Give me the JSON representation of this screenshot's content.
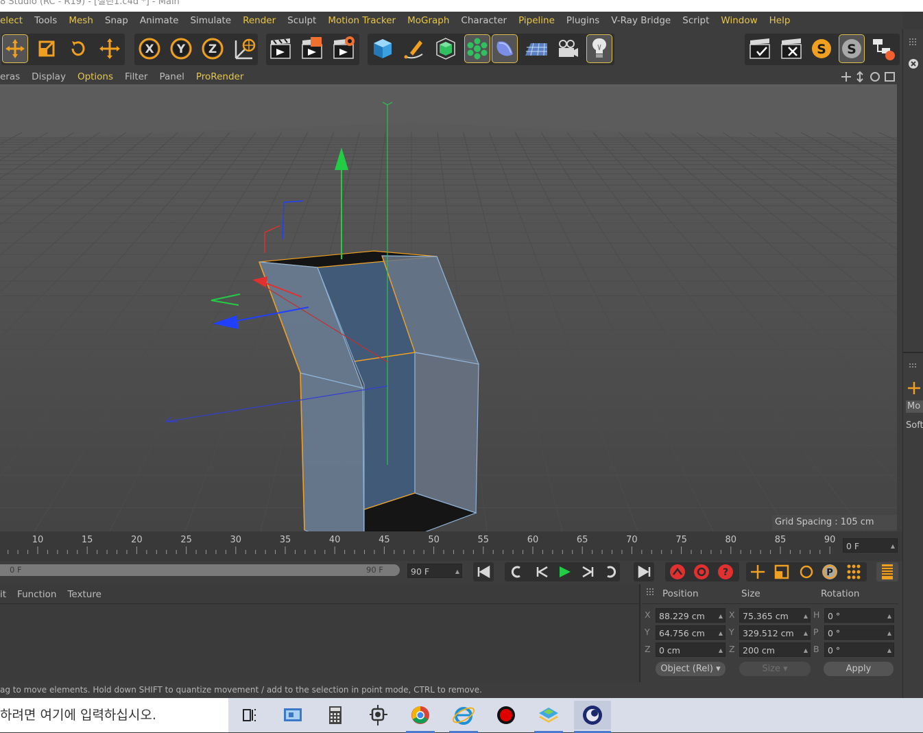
{
  "window": {
    "title": "8 Studio (RC - R19) - [실린1.c4d *] - Main"
  },
  "menu": {
    "items": [
      {
        "label": "elect",
        "hl": true
      },
      {
        "label": "Tools",
        "hl": false
      },
      {
        "label": "Mesh",
        "hl": true
      },
      {
        "label": "Snap",
        "hl": false
      },
      {
        "label": "Animate",
        "hl": false
      },
      {
        "label": "Simulate",
        "hl": false
      },
      {
        "label": "Render",
        "hl": true
      },
      {
        "label": "Sculpt",
        "hl": false
      },
      {
        "label": "Motion Tracker",
        "hl": true
      },
      {
        "label": "MoGraph",
        "hl": true
      },
      {
        "label": "Character",
        "hl": false
      },
      {
        "label": "Pipeline",
        "hl": true
      },
      {
        "label": "Plugins",
        "hl": false
      },
      {
        "label": "V-Ray Bridge",
        "hl": false
      },
      {
        "label": "Script",
        "hl": false
      },
      {
        "label": "Window",
        "hl": true
      },
      {
        "label": "Help",
        "hl": true
      }
    ]
  },
  "toolbar": {
    "icons": [
      "move-icon",
      "scale-icon",
      "rotate-icon",
      "move-alt-icon",
      "x-axis-icon",
      "y-axis-icon",
      "z-axis-icon",
      "world-coord-icon",
      "render-view-icon",
      "render-picture-viewer-icon",
      "render-settings-icon",
      "cube-icon",
      "pen-icon",
      "subdivision-icon",
      "cloner-icon",
      "deformer-icon",
      "floor-icon",
      "camera-icon",
      "light-icon"
    ],
    "right_icons": [
      "render-check-icon",
      "render-x-icon",
      "s-plugin-orange-icon",
      "s-plugin-gray-icon",
      "hierarchy-icon"
    ]
  },
  "viewport_menu": {
    "items": [
      {
        "label": "eras",
        "hl": false
      },
      {
        "label": "Display",
        "hl": false
      },
      {
        "label": "Options",
        "hl": true
      },
      {
        "label": "Filter",
        "hl": false
      },
      {
        "label": "Panel",
        "hl": false
      },
      {
        "label": "ProRender",
        "hl": true
      }
    ]
  },
  "viewport": {
    "grid_spacing": "Grid Spacing : 105 cm"
  },
  "timeline": {
    "ticks": [
      "10",
      "15",
      "20",
      "25",
      "30",
      "35",
      "40",
      "45",
      "50",
      "55",
      "60",
      "65",
      "70",
      "75",
      "80",
      "85",
      "90"
    ],
    "current_frame": "0 F"
  },
  "range": {
    "start": "0 F",
    "end": "90 F",
    "max": "90 F"
  },
  "material_menu": {
    "items": [
      "it",
      "Function",
      "Texture"
    ]
  },
  "coords": {
    "headers": {
      "position": "Position",
      "size": "Size",
      "rotation": "Rotation"
    },
    "rows": [
      {
        "pos_axis": "X",
        "pos": "88.229 cm",
        "size_axis": "X",
        "size": "75.365 cm",
        "rot_axis": "H",
        "rot": "0 °"
      },
      {
        "pos_axis": "Y",
        "pos": "64.756 cm",
        "size_axis": "Y",
        "size": "329.512 cm",
        "rot_axis": "P",
        "rot": "0 °"
      },
      {
        "pos_axis": "Z",
        "pos": "0 cm",
        "size_axis": "Z",
        "size": "200 cm",
        "rot_axis": "B",
        "rot": "0 °"
      }
    ],
    "mode": "Object (Rel)",
    "size_mode": "Size",
    "apply": "Apply"
  },
  "status": {
    "text": "ag to move elements. Hold down SHIFT to quantize movement / add to the selection in point mode, CTRL to remove."
  },
  "right_panel": {
    "labels": [
      "Mo",
      "Soft"
    ]
  },
  "taskbar": {
    "search_text": "하려면 여기에 입력하십시오."
  },
  "colors": {
    "accent": "#e8c64a",
    "icon_orange": "#f0a020",
    "panel": "#3d3d3d",
    "viewport": "#3a3a3a",
    "axis_x": "#e03030",
    "axis_y": "#22cc44",
    "axis_z": "#2040ff",
    "object_fill": "#5a7390",
    "object_edge": "#8fb4d8",
    "selected_edge": "#f0a020"
  }
}
